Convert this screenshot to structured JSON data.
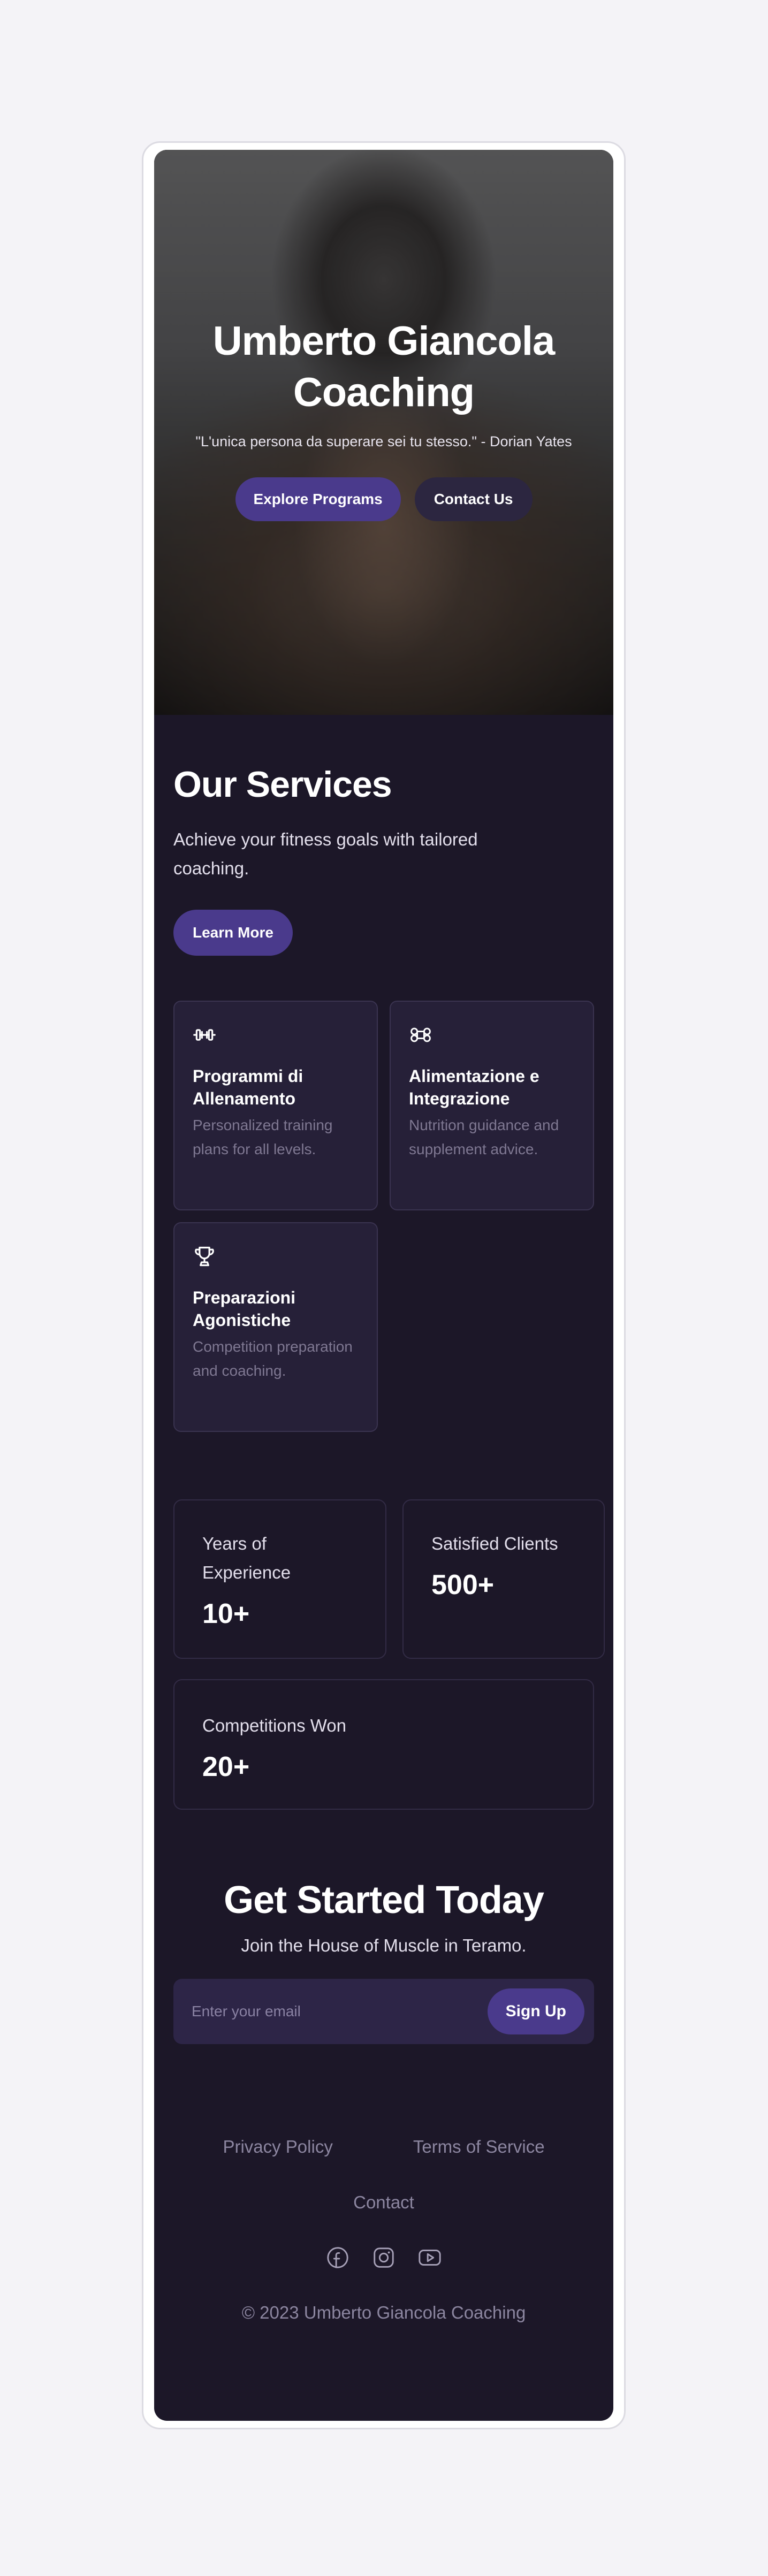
{
  "hero": {
    "title": "Umberto Giancola Coaching",
    "quote": "\"L'unica persona da superare sei tu stesso.\" - Dorian Yates",
    "primary_button": "Explore Programs",
    "secondary_button": "Contact Us"
  },
  "services": {
    "heading": "Our Services",
    "description": "Achieve your fitness goals with tailored coaching.",
    "button": "Learn More",
    "items": [
      {
        "icon": "dumbbell-icon",
        "title": "Programmi di Allenamento",
        "text": "Personalized training plans for all levels."
      },
      {
        "icon": "command-icon",
        "title": "Alimentazione e Integrazione",
        "text": "Nutrition guidance and supplement advice."
      },
      {
        "icon": "trophy-icon",
        "title": "Preparazioni Agonistiche",
        "text": "Competition preparation and coaching."
      }
    ]
  },
  "stats": {
    "items": [
      {
        "label": "Years of Experience",
        "value": "10+"
      },
      {
        "label": "Satisfied Clients",
        "value": "500+"
      },
      {
        "label": "Competitions Won",
        "value": "20+"
      }
    ]
  },
  "cta": {
    "title": "Get Started Today",
    "subtitle": "Join the House of Muscle in Teramo.",
    "email_placeholder": "Enter your email",
    "button": "Sign Up"
  },
  "footer": {
    "links": [
      "Privacy Policy",
      "Terms of Service"
    ],
    "contact": "Contact",
    "socials": [
      "facebook-icon",
      "instagram-icon",
      "youtube-icon"
    ],
    "copyright": "© 2023 Umberto Giancola Coaching"
  },
  "colors": {
    "background": "#1c1728",
    "accent": "#4a3a8c",
    "card": "#262038"
  }
}
